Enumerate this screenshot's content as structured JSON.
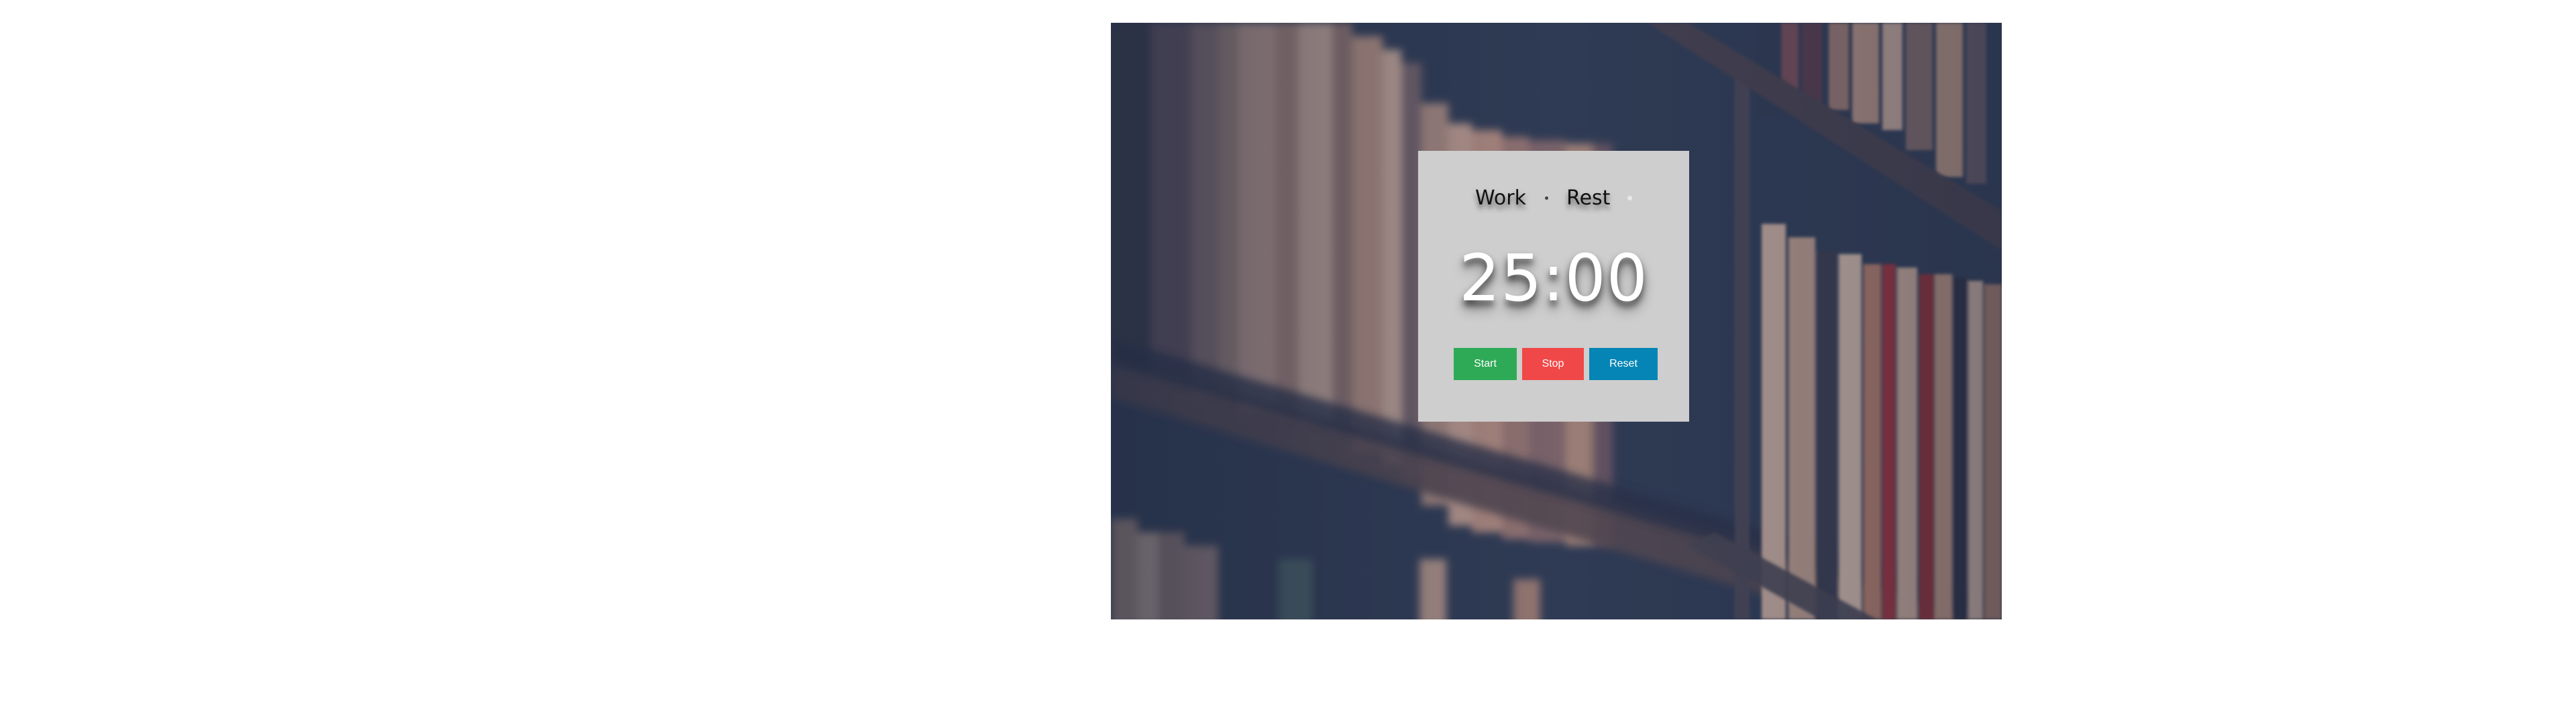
{
  "timer": {
    "modes": {
      "work_label": "Work",
      "rest_label": "Rest"
    },
    "time": "25:00"
  },
  "controls": {
    "start_label": "Start",
    "stop_label": "Stop",
    "reset_label": "Reset"
  },
  "colors": {
    "card_background": "#cecece",
    "start": "#2eaa56",
    "stop": "#f04848",
    "reset": "#0585b5",
    "time_text": "#ffffff"
  },
  "background_image": "blurred-bookshelf-photo"
}
